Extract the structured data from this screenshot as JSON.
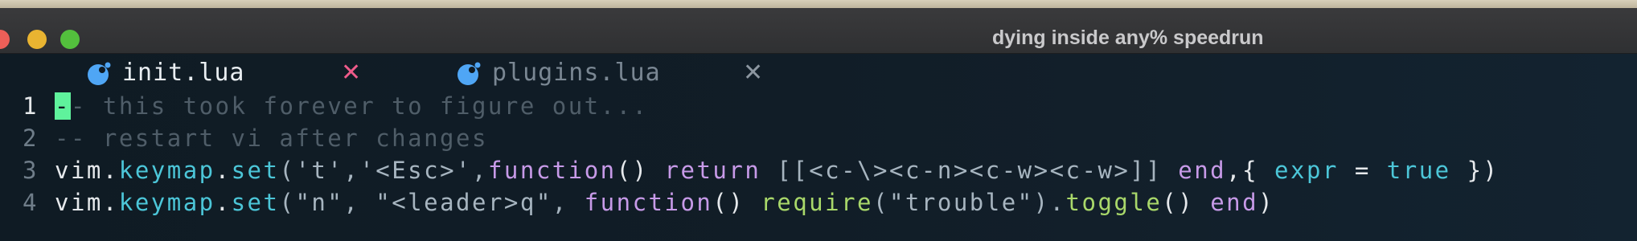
{
  "window": {
    "title": "dying inside any% speedrun"
  },
  "tabs": [
    {
      "label": "init.lua",
      "icon": "lua-icon",
      "active": true
    },
    {
      "label": "plugins.lua",
      "icon": "lua-icon",
      "active": false
    }
  ],
  "close_glyph": "✕",
  "lines": [
    {
      "number": "1",
      "cursor_char": "-",
      "rest": "- this took forever to figure out..."
    },
    {
      "number": "2",
      "text": "-- restart vi after changes"
    },
    {
      "number": "3",
      "segments": [
        "vim",
        ".",
        "keymap",
        ".",
        "set",
        "('t','<Esc>',",
        "function",
        "() ",
        "return",
        " [[<c-\\><c-n><c-w><c-w>]] ",
        "end",
        ",{ ",
        "expr",
        " = ",
        "true",
        " })"
      ]
    },
    {
      "number": "4",
      "segments": [
        "vim",
        ".",
        "keymap",
        ".",
        "set",
        "(\"n\", \"<leader>q\", ",
        "function",
        "() ",
        "require",
        "(\"trouble\").",
        "toggle",
        "() ",
        "end",
        ")"
      ]
    }
  ],
  "colors": {
    "cursor": "#5ff29c",
    "comment": "#4f5d68",
    "field": "#4cc6d8",
    "keyword": "#c79ae8",
    "function": "#a9d86a",
    "active_close": "#ee5b8a"
  }
}
